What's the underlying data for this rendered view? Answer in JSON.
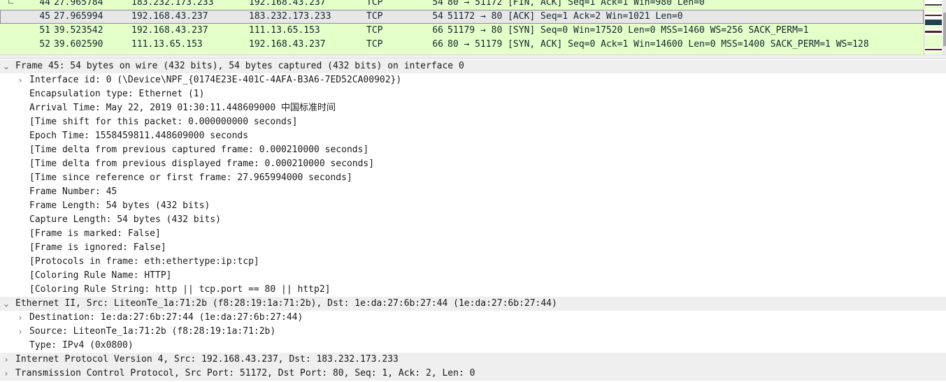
{
  "packet_list": {
    "rows": [
      {
        "no": "44",
        "time": "27.965784",
        "src": "183.232.173.233",
        "dst": "192.168.43.237",
        "proto": "TCP",
        "len": "54",
        "info": "80 → 51172 [FIN, ACK] Seq=1 Ack=1 Win=980 Len=0",
        "selected": false
      },
      {
        "no": "45",
        "time": "27.965994",
        "src": "192.168.43.237",
        "dst": "183.232.173.233",
        "proto": "TCP",
        "len": "54",
        "info": "51172 → 80 [ACK] Seq=1 Ack=2 Win=1021 Len=0",
        "selected": true
      },
      {
        "no": "51",
        "time": "39.523542",
        "src": "192.168.43.237",
        "dst": "111.13.65.153",
        "proto": "TCP",
        "len": "66",
        "info": "51179 → 80 [SYN] Seq=0 Win=17520 Len=0 MSS=1460 WS=256 SACK_PERM=1",
        "selected": false
      },
      {
        "no": "52",
        "time": "39.602590",
        "src": "111.13.65.153",
        "dst": "192.168.43.237",
        "proto": "TCP",
        "len": "66",
        "info": "80 → 51179 [SYN, ACK] Seq=0 Ack=1 Win=14600 Len=0 MSS=1400 SACK_PERM=1 WS=128",
        "selected": false
      }
    ],
    "colors": {
      "row_bg": "#e4ffc7",
      "selected_bg": "#e7e7e7"
    }
  },
  "details": {
    "frame": {
      "header": "Frame 45: 54 bytes on wire (432 bits), 54 bytes captured (432 bits) on interface 0",
      "interface_id": "Interface id: 0 (\\Device\\NPF_{0174E23E-401C-4AFA-B3A6-7ED52CA00902})",
      "encapsulation": "Encapsulation type: Ethernet (1)",
      "arrival_prefix": "Arrival Time: May 22, 2019 01:30:11.448609000 ",
      "arrival_tz": "中国标准时间",
      "time_shift": "[Time shift for this packet: 0.000000000 seconds]",
      "epoch": "Epoch Time: 1558459811.448609000 seconds",
      "delta_captured": "[Time delta from previous captured frame: 0.000210000 seconds]",
      "delta_displayed": "[Time delta from previous displayed frame: 0.000210000 seconds]",
      "since_reference": "[Time since reference or first frame: 27.965994000 seconds]",
      "frame_number": "Frame Number: 45",
      "frame_length": "Frame Length: 54 bytes (432 bits)",
      "capture_length": "Capture Length: 54 bytes (432 bits)",
      "marked": "[Frame is marked: False]",
      "ignored": "[Frame is ignored: False]",
      "protocols": "[Protocols in frame: eth:ethertype:ip:tcp]",
      "rule_name": "[Coloring Rule Name: HTTP]",
      "rule_string": "[Coloring Rule String: http || tcp.port == 80 || http2]"
    },
    "ethernet": {
      "header": "Ethernet II, Src: LiteonTe_1a:71:2b (f8:28:19:1a:71:2b), Dst: 1e:da:27:6b:27:44 (1e:da:27:6b:27:44)",
      "destination": "Destination: 1e:da:27:6b:27:44 (1e:da:27:6b:27:44)",
      "source": "Source: LiteonTe_1a:71:2b (f8:28:19:1a:71:2b)",
      "type": "Type: IPv4 (0x0800)"
    },
    "ip": {
      "header": "Internet Protocol Version 4, Src: 192.168.43.237, Dst: 183.232.173.233"
    },
    "tcp": {
      "header": "Transmission Control Protocol, Src Port: 51172, Dst Port: 80, Seq: 1, Ack: 2, Len: 0"
    },
    "icons": {
      "expanded": "chevron-down-icon",
      "collapsed": "chevron-right-icon"
    }
  }
}
